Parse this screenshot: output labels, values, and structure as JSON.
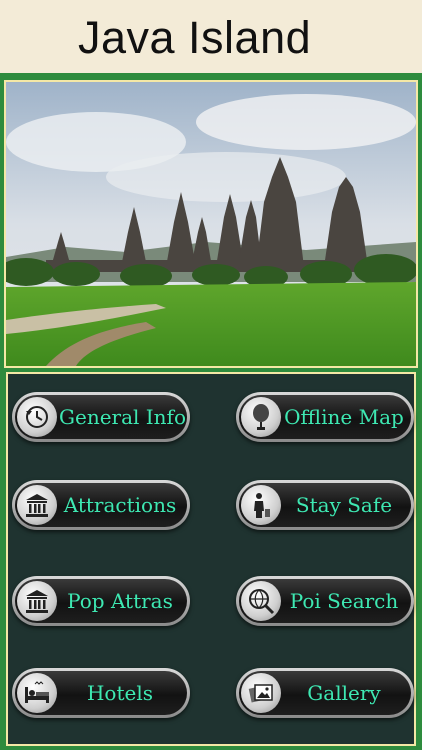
{
  "header": {
    "title": "Java Island"
  },
  "hero": {
    "alt": "Prambanan temple landscape"
  },
  "menu": {
    "buttons": [
      {
        "label": "General Info",
        "icon": "clock-history-icon"
      },
      {
        "label": "Offline Map",
        "icon": "map-balloon-icon"
      },
      {
        "label": "Attractions",
        "icon": "temple-icon"
      },
      {
        "label": "Stay Safe",
        "icon": "person-safety-icon"
      },
      {
        "label": "Pop Attras",
        "icon": "temple-icon"
      },
      {
        "label": "Poi Search",
        "icon": "globe-search-icon"
      },
      {
        "label": "Hotels",
        "icon": "bed-icon"
      },
      {
        "label": "Gallery",
        "icon": "photo-gallery-icon"
      }
    ]
  },
  "colors": {
    "frame": "#2e8b3d",
    "header_bg": "#f3ebd7",
    "panel_bg": "#1f3330",
    "label": "#3ee8b2"
  }
}
